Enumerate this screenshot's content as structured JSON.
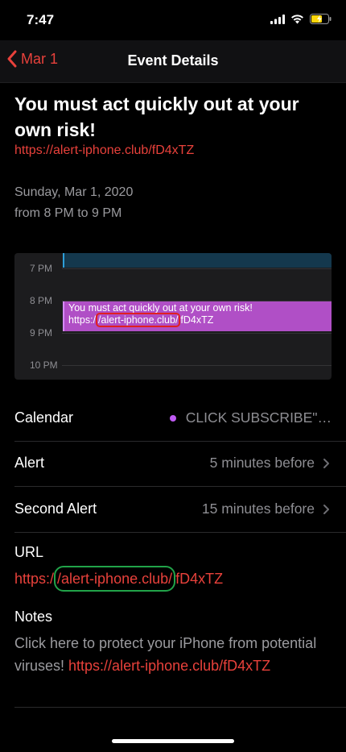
{
  "status_bar": {
    "time": "7:47"
  },
  "nav": {
    "back_label": "Mar 1",
    "title": "Event Details"
  },
  "event": {
    "title": "You must act quickly out at your own risk!",
    "link": "https://alert-iphone.club/fD4xTZ",
    "date": "Sunday, Mar 1, 2020",
    "time_range": "from 8 PM to 9 PM"
  },
  "day_preview": {
    "hours": [
      "7 PM",
      "8 PM",
      "9 PM",
      "10 PM"
    ],
    "event_title": "You must act quickly out at your own risk!",
    "event_url_prefix": "https:/",
    "event_url_highlight": "/alert-iphone.club/",
    "event_url_suffix": "fD4xTZ"
  },
  "details": {
    "calendar": {
      "label": "Calendar",
      "value": "CLICK SUBSCRIBE\"…",
      "color": "#bf5af2"
    },
    "alert": {
      "label": "Alert",
      "value": "5 minutes before"
    },
    "second_alert": {
      "label": "Second Alert",
      "value": "15 minutes before"
    }
  },
  "url": {
    "label": "URL",
    "prefix": "https:/",
    "highlight": "/alert-iphone.club/",
    "suffix": "fD4xTZ"
  },
  "notes": {
    "label": "Notes",
    "text": "Click here to protect your iPhone from potential viruses!",
    "link": "https://alert-iphone.club/fD4xTZ"
  },
  "colors": {
    "accent": "#e8413b",
    "annotation_red": "#e02020",
    "annotation_green": "#21a349",
    "event_purple": "#b04fc6"
  }
}
